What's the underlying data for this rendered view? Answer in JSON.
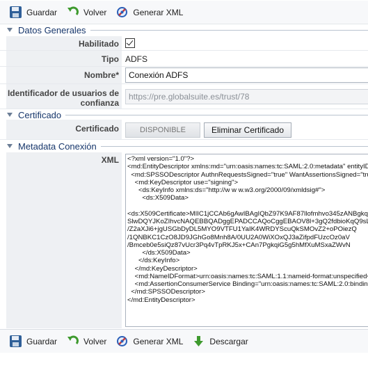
{
  "toolbar_top": {
    "save_label": "Guardar",
    "back_label": "Volver",
    "xml_label": "Generar XML"
  },
  "sections": {
    "general": "Datos Generales",
    "certificate": "Certificado",
    "metadata": "Metadata Conexión"
  },
  "form": {
    "enabled_label": "Habilitado",
    "enabled_checked": true,
    "type_label": "Tipo",
    "type_value": "ADFS",
    "name_label": "Nombre*",
    "name_value": "Conexión ADFS",
    "idp_label_line1": "Identificador de usuarios de",
    "idp_label_line2": "confianza",
    "idp_value": "https://pre.globalsuite.es/trust/78"
  },
  "certificate": {
    "label": "Certificado",
    "status": "DISPONIBLE",
    "delete_label": "Eliminar Certificado"
  },
  "metadata": {
    "label": "XML",
    "xml": "<?xml version=\"1.0\"?>\n<md:EntityDescriptor xmlns:md=\"urn:oasis:names:tc:SAML:2.0:metadata\" entityID=\"https://pre.globalsuite.es/trust/78\">\n  <md:SPSSODescriptor AuthnRequestsSigned=\"true\" WantAssertionsSigned=\"true\" protocolSupportEnumeration=\"urn:oasis:names:tc:SAML:2.0:protocol\">\n    <md:KeyDescriptor use=\"signing\">\n      <ds:KeyInfo xmlns:ds=\"http://w w w.w3.org/2000/09/xmldsig#\">\n        <ds:X509Data>\n\n<ds:X509Certificate>MIIC1jCCAb6gAwIBAgIQbZ97K9AF87llofmhvo345zANBgkqhkiG9w0B\nSlwDQYJKoZIhvcNAQEBBQADggEPADCCAQoCggEBAOV8l+3gQ2fdbioKqQ9sL\n/Z2aXJi6+jgUSGbDyDL5MYO9VTFU1YaIK4WRDYScuQkSMOvZ2+oPOiezQ\n/1QNBKC1CzO8JD9JGhGo8Mnh8A/0UU2A0WiXOxQJ3aZifpdFUzcOz0aV\n/Bmceb0e5siQz87vUcr3Pq4vTpRKJ5x+CAn7PgkqiG5g5hMfXuMSxaZWvN\n        </ds:X509Data>\n      </ds:KeyInfo>\n    </md:KeyDescriptor>\n    <md:NameIDFormat>urn:oasis:names:tc:SAML:1.1:nameid-format:unspecified</md:NameIDFormat>\n    <md:AssertionConsumerService Binding=\"urn:oasis:names:tc:SAML:2.0:bindings:HTTP-POST\"/>\n  </md:SPSSODescriptor>\n</md:EntityDescriptor>"
  },
  "toolbar_bottom": {
    "save_label": "Guardar",
    "back_label": "Volver",
    "xml_label": "Generar XML",
    "download_label": "Descargar"
  }
}
